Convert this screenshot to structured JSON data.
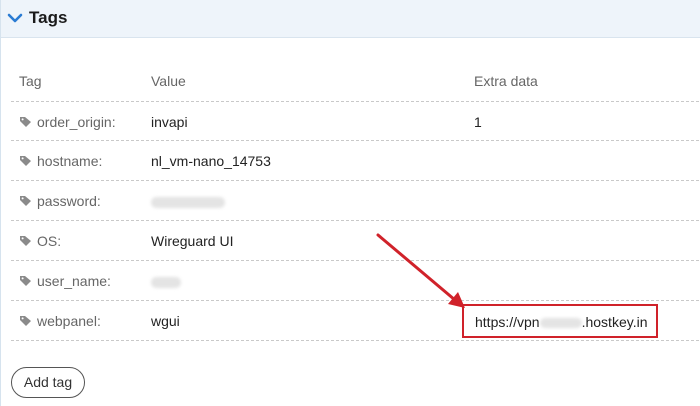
{
  "section": {
    "title": "Tags",
    "icon": "chevron-down-icon"
  },
  "columns": {
    "tag": "Tag",
    "value": "Value",
    "extra": "Extra data"
  },
  "rows": [
    {
      "tag": "order_origin:",
      "value": "invapi",
      "extra": "1",
      "value_redacted": false
    },
    {
      "tag": "hostname:",
      "value": "nl_vm-nano_14753",
      "extra": "",
      "value_redacted": false
    },
    {
      "tag": "password:",
      "value": "",
      "extra": "",
      "value_redacted": true
    },
    {
      "tag": "OS:",
      "value": "Wireguard UI",
      "extra": "",
      "value_redacted": false
    },
    {
      "tag": "user_name:",
      "value": "",
      "extra": "",
      "value_redacted": true
    },
    {
      "tag": "webpanel:",
      "value": "wgui",
      "extra": "",
      "value_redacted": false
    }
  ],
  "webpanel_extra": {
    "prefix": "https://vpn",
    "suffix": ".hostkey.in"
  },
  "annotation": {
    "arrow_color": "#d0222a",
    "box_color": "#d0222a"
  },
  "add_tag_label": "Add tag",
  "tag_icon": "tag-icon"
}
